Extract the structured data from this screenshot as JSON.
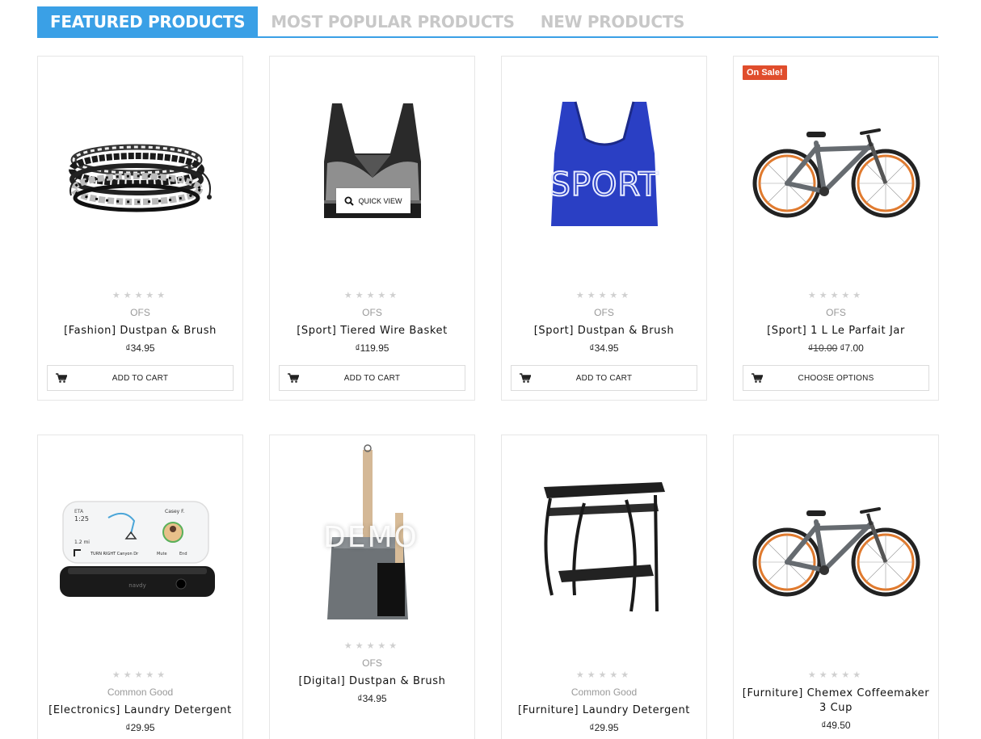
{
  "tabs": [
    {
      "label": "FEATURED PRODUCTS",
      "active": true
    },
    {
      "label": "MOST POPULAR PRODUCTS",
      "active": false
    },
    {
      "label": "NEW PRODUCTS",
      "active": false
    }
  ],
  "colors": {
    "accent": "#3aa0e6",
    "sale": "#e04d2c"
  },
  "stars_glyph": "★★★★★",
  "products": [
    {
      "brand": "OFS",
      "name": "[Fashion] Dustpan & Brush",
      "price": "₫34.95",
      "button": "ADD TO CART",
      "image": "bracelet"
    },
    {
      "brand": "OFS",
      "name": "[Sport] Tiered Wire Basket",
      "price": "₫119.95",
      "button": "ADD TO CART",
      "image": "sports-bra-black",
      "quick_view": "QUICK VIEW"
    },
    {
      "brand": "OFS",
      "name": "[Sport] Dustpan & Brush",
      "price": "₫34.95",
      "button": "ADD TO CART",
      "image": "sports-bra-blue",
      "print": "SPORT"
    },
    {
      "brand": "OFS",
      "name": "[Sport] 1 L Le Parfait Jar",
      "old_price": "₫10.00",
      "price": "₫7.00",
      "button": "CHOOSE OPTIONS",
      "image": "bicycle",
      "badge": "On Sale!"
    },
    {
      "brand": "Common Good",
      "name": "[Electronics] Laundry Detergent",
      "price": "₫29.95",
      "image": "navdy",
      "screen": {
        "eta_label": "ETA",
        "eta": "1:25",
        "contact": "Casey F.",
        "distance": "1.2 mi",
        "turn": "TURN RIGHT Canyon Dr",
        "mute": "Mute",
        "end": "End",
        "logo": "navdy"
      }
    },
    {
      "brand": "OFS",
      "name": "[Digital] Dustpan & Brush",
      "price": "₫34.95",
      "image": "dustpan",
      "watermark": "DEMO"
    },
    {
      "brand": "Common Good",
      "name": "[Furniture] Laundry Detergent",
      "price": "₫29.95",
      "image": "desk"
    },
    {
      "brand": "",
      "name": "[Furniture] Chemex Coffeemaker 3 Cup",
      "price": "₫49.50",
      "image": "bicycle"
    }
  ]
}
